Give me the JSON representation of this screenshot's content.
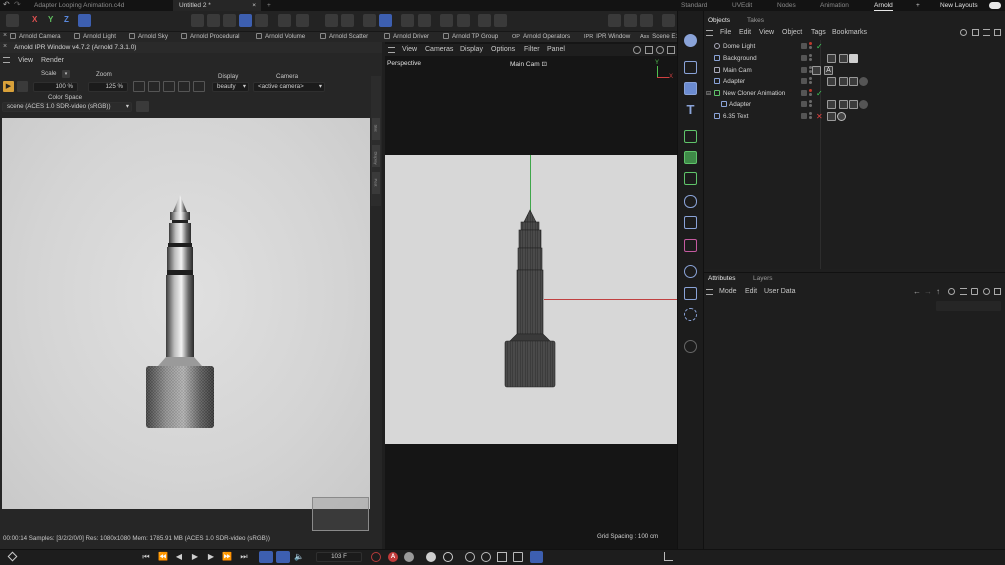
{
  "window": {
    "doc_tabs": [
      "Adapter Looping Animation.c4d",
      "Untitled 2 *"
    ],
    "layouts": [
      "Standard",
      "UVEdit",
      "Nodes",
      "Animation",
      "Arnold"
    ],
    "active_layout": "Arnold",
    "new_layouts": "New Layouts",
    "add_tab": "+",
    "close_tab": "×"
  },
  "toolbar": {
    "axis": [
      "X",
      "Y",
      "Z"
    ]
  },
  "arnold_bar": {
    "items": [
      "Arnold Camera",
      "Arnold Light",
      "Arnold Sky",
      "Arnold Procedural",
      "Arnold Volume",
      "Arnold Scatter",
      "Arnold Driver",
      "Arnold TP Group",
      "Arnold Operators",
      "IPR Window",
      "Scene E:"
    ],
    "op_badge": "OP",
    "ipr_badge": "IPR",
    "ass_badge": "Ass"
  },
  "ipr": {
    "title": "Arnold IPR Window v4.7.2 (Arnold 7.3.1.0)",
    "menu": [
      "View",
      "Render"
    ],
    "scale_label": "Scale",
    "scale_value": "100 %",
    "zoom_label": "Zoom",
    "zoom_value": "125 %",
    "display_label": "Display",
    "display_value": "beauty",
    "camera_label": "Camera",
    "camera_value": "<active camera>",
    "colorspace_label": "Color Space",
    "colorspace_value": "scene (ACES 1.0 SDR-video (sRGB))",
    "status": "00:00:14  Samples: [3/2/2/0/0]  Res: 1080x1080  Mem: 1785.91 MB  (ACES 1.0 SDR-video (sRGB))",
    "side_tabs": [
      "Stat",
      "Display",
      "Post"
    ]
  },
  "viewport": {
    "menu": [
      "View",
      "Cameras",
      "Display",
      "Options",
      "Filter",
      "Panel"
    ],
    "name": "Perspective",
    "camera": "Main Cam",
    "grid_spacing": "Grid Spacing : 100 cm",
    "axis_y": "Y",
    "axis_x": "X"
  },
  "objects_panel": {
    "tabs": [
      "Objects",
      "Takes"
    ],
    "menu": [
      "File",
      "Edit",
      "View",
      "Object",
      "Tags",
      "Bookmarks"
    ],
    "rows": [
      {
        "name": "Dome Light",
        "indent": 0,
        "status": "check"
      },
      {
        "name": "Background",
        "indent": 0,
        "status": ""
      },
      {
        "name": "Main Cam",
        "indent": 0,
        "status": ""
      },
      {
        "name": "Adapter",
        "indent": 0,
        "status": ""
      },
      {
        "name": "New Cloner Animation",
        "indent": 0,
        "status": "check"
      },
      {
        "name": "Adapter",
        "indent": 1,
        "status": ""
      },
      {
        "name": "6.35 Text",
        "indent": 0,
        "status": "x"
      }
    ],
    "tag_letter": "A"
  },
  "attributes_panel": {
    "tabs": [
      "Attributes",
      "Layers"
    ],
    "menu": [
      "Mode",
      "Edit",
      "User Data"
    ]
  },
  "timeline": {
    "frame": "103 F",
    "record_badge": "A"
  },
  "colors": {
    "accent": "#3d5fb0",
    "check": "#3fcf5a",
    "cross": "#e04040",
    "render_bg": "#d9d9d9"
  }
}
